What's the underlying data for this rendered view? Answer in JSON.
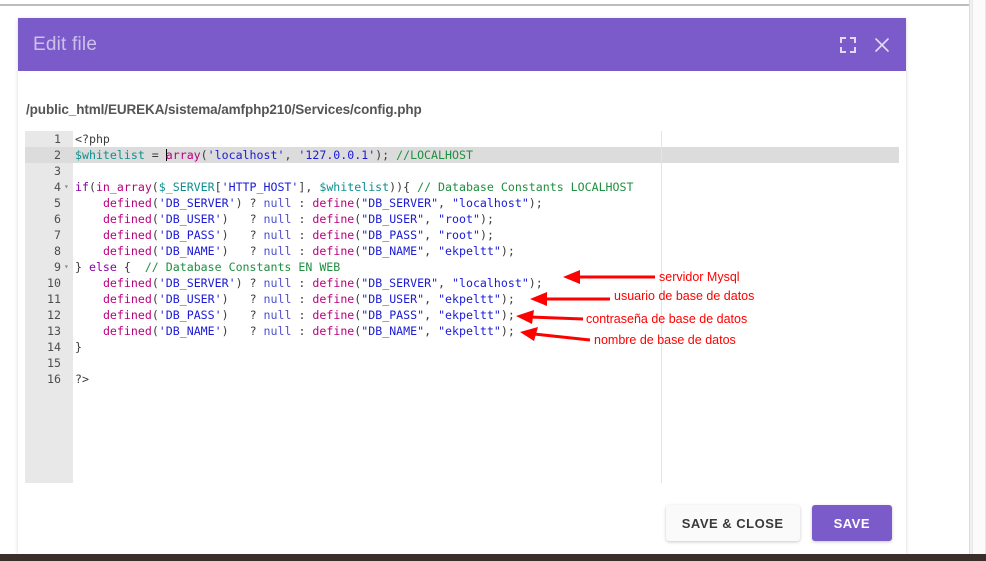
{
  "dialog": {
    "title": "Edit file",
    "file_path": "/public_html/EUREKA/sistema/amfphp210/Services/config.php",
    "header_color": "#7b5bc9",
    "icons": {
      "fullscreen": "fullscreen-icon",
      "close": "close-icon"
    }
  },
  "editor": {
    "lines": [
      {
        "n": "1",
        "fold": "",
        "text": "<?php"
      },
      {
        "n": "2",
        "fold": "",
        "text": "$whitelist = array('localhost', '127.0.0.1'); //LOCALHOST"
      },
      {
        "n": "3",
        "fold": "",
        "text": ""
      },
      {
        "n": "4",
        "fold": "▾",
        "text": "if(in_array($_SERVER['HTTP_HOST'], $whitelist)){ // Database Constants LOCALHOST"
      },
      {
        "n": "5",
        "fold": "",
        "text": "    defined('DB_SERVER') ? null : define(\"DB_SERVER\", \"localhost\");"
      },
      {
        "n": "6",
        "fold": "",
        "text": "    defined('DB_USER')   ? null : define(\"DB_USER\", \"root\");"
      },
      {
        "n": "7",
        "fold": "",
        "text": "    defined('DB_PASS')   ? null : define(\"DB_PASS\", \"root\");"
      },
      {
        "n": "8",
        "fold": "",
        "text": "    defined('DB_NAME')   ? null : define(\"DB_NAME\", \"ekpeltt\");"
      },
      {
        "n": "9",
        "fold": "▾",
        "text": "} else {  // Database Constants EN WEB"
      },
      {
        "n": "10",
        "fold": "",
        "text": "    defined('DB_SERVER') ? null : define(\"DB_SERVER\", \"localhost\");"
      },
      {
        "n": "11",
        "fold": "",
        "text": "    defined('DB_USER')   ? null : define(\"DB_USER\", \"ekpeltt\");"
      },
      {
        "n": "12",
        "fold": "",
        "text": "    defined('DB_PASS')   ? null : define(\"DB_PASS\", \"ekpeltt\");"
      },
      {
        "n": "13",
        "fold": "",
        "text": "    defined('DB_NAME')   ? null : define(\"DB_NAME\", \"ekpeltt\");"
      },
      {
        "n": "14",
        "fold": "",
        "text": "}"
      },
      {
        "n": "15",
        "fold": "",
        "text": ""
      },
      {
        "n": "16",
        "fold": "",
        "text": "?>"
      }
    ],
    "active_line": "2",
    "line_numbers": [
      "1",
      "2",
      "3",
      "4",
      "5",
      "6",
      "7",
      "8",
      "9",
      "10",
      "11",
      "12",
      "13",
      "14",
      "15",
      "16"
    ]
  },
  "annotations": {
    "color": "#ff0000",
    "items": [
      {
        "label": "servidor Mysql",
        "target_line": "10"
      },
      {
        "label": "usuario de base de datos",
        "target_line": "11"
      },
      {
        "label": "contraseña de base de datos",
        "target_line": "12"
      },
      {
        "label": "nombre de base de datos",
        "target_line": "13"
      }
    ]
  },
  "footer": {
    "save_close_label": "SAVE & CLOSE",
    "save_label": "SAVE"
  }
}
